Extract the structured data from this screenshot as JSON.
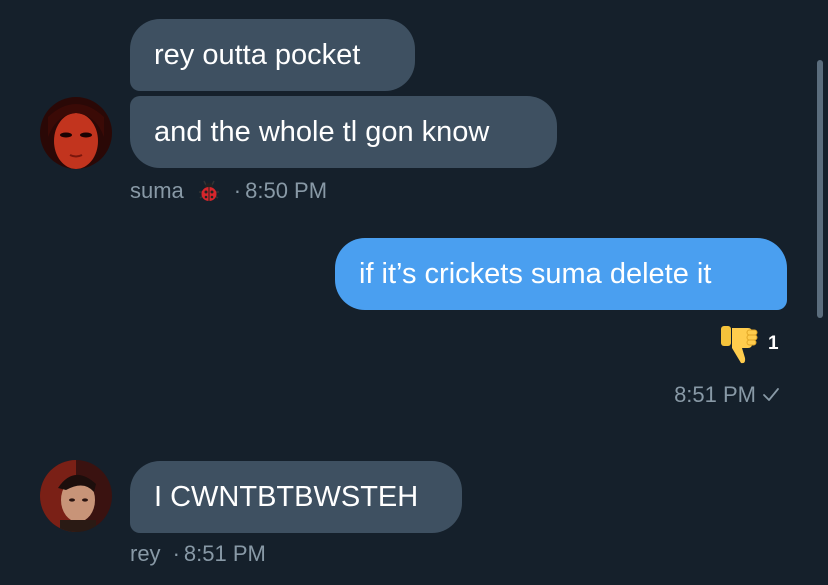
{
  "conversation": {
    "messages": [
      {
        "sender": "suma",
        "bubbles": [
          "rey outta pocket",
          "and the whole tl gon know"
        ],
        "emoji_icon": "ladybug-icon",
        "time": "8:50 PM"
      },
      {
        "sender": "me",
        "bubbles": [
          "if it’s crickets suma delete it"
        ],
        "reaction": {
          "icon": "thumbs-down-icon",
          "count": "1"
        },
        "time": "8:51 PM",
        "status_icon": "checkmark-icon"
      },
      {
        "sender": "rey",
        "bubbles": [
          "I CWNTBTBWSTEH"
        ],
        "time": "8:51 PM"
      }
    ]
  },
  "colors": {
    "background": "#15202b",
    "received_bubble": "#3e5061",
    "sent_bubble": "#4a9ff0",
    "meta_text": "#8899a6"
  },
  "separator": "·"
}
